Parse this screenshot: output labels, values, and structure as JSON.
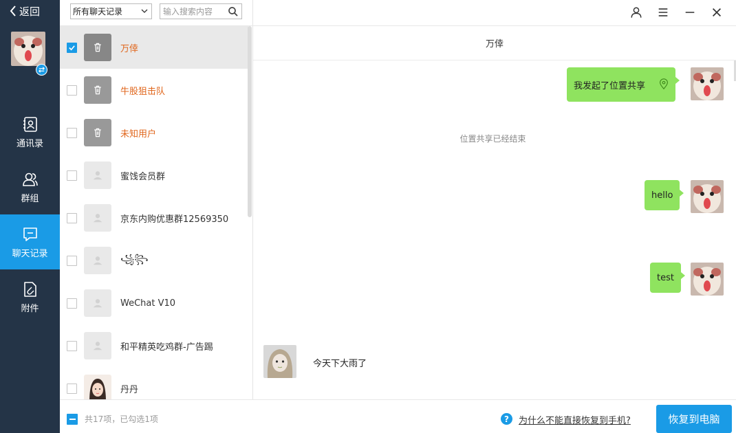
{
  "nav": {
    "back_label": "返回",
    "items": [
      {
        "label": "通讯录",
        "icon": "contacts-icon"
      },
      {
        "label": "群组",
        "icon": "group-icon"
      },
      {
        "label": "聊天记录",
        "icon": "chat-icon"
      },
      {
        "label": "附件",
        "icon": "attachment-icon"
      }
    ],
    "active_index": 2
  },
  "filter": {
    "select_value": "所有聊天记录",
    "search_placeholder": "输入搜索内容"
  },
  "list": {
    "items": [
      {
        "name": "万倖",
        "checked": true,
        "avatar": "deleted",
        "name_color": "orange"
      },
      {
        "name": "牛股狙击队",
        "checked": false,
        "avatar": "deleted",
        "name_color": "orange"
      },
      {
        "name": "未知用户",
        "checked": false,
        "avatar": "deleted",
        "name_color": "orange"
      },
      {
        "name": "蜜饯会员群",
        "checked": false,
        "avatar": "group",
        "name_color": "default"
      },
      {
        "name": "京东内购优惠群12569350",
        "checked": false,
        "avatar": "group",
        "name_color": "default"
      },
      {
        "name": "꧁꧂",
        "checked": false,
        "avatar": "group",
        "name_color": "default"
      },
      {
        "name": "WeChat V10",
        "checked": false,
        "avatar": "group",
        "name_color": "default"
      },
      {
        "name": "和平精英吃鸡群-广告踢",
        "checked": false,
        "avatar": "group",
        "name_color": "default"
      },
      {
        "name": "丹丹",
        "checked": false,
        "avatar": "photo",
        "name_color": "default"
      }
    ],
    "footer_count": "共17项，已勾选1项"
  },
  "chat": {
    "title": "万倖",
    "messages": [
      {
        "type": "out",
        "text": "我发起了位置共享",
        "icon": "location-pin-icon"
      },
      {
        "type": "system",
        "text": "位置共享已经结束"
      },
      {
        "type": "out",
        "text": "hello"
      },
      {
        "type": "out",
        "text": "test"
      },
      {
        "type": "in",
        "text": "今天下大雨了"
      }
    ]
  },
  "footer": {
    "help_icon_text": "?",
    "help_link": "为什么不能直接恢复到手机?",
    "restore_button": "恢复到电脑"
  },
  "colors": {
    "nav_bg": "#243447",
    "accent": "#1a9be6",
    "bubble_green": "#8fe35f",
    "deleted_name": "#e0661c"
  }
}
